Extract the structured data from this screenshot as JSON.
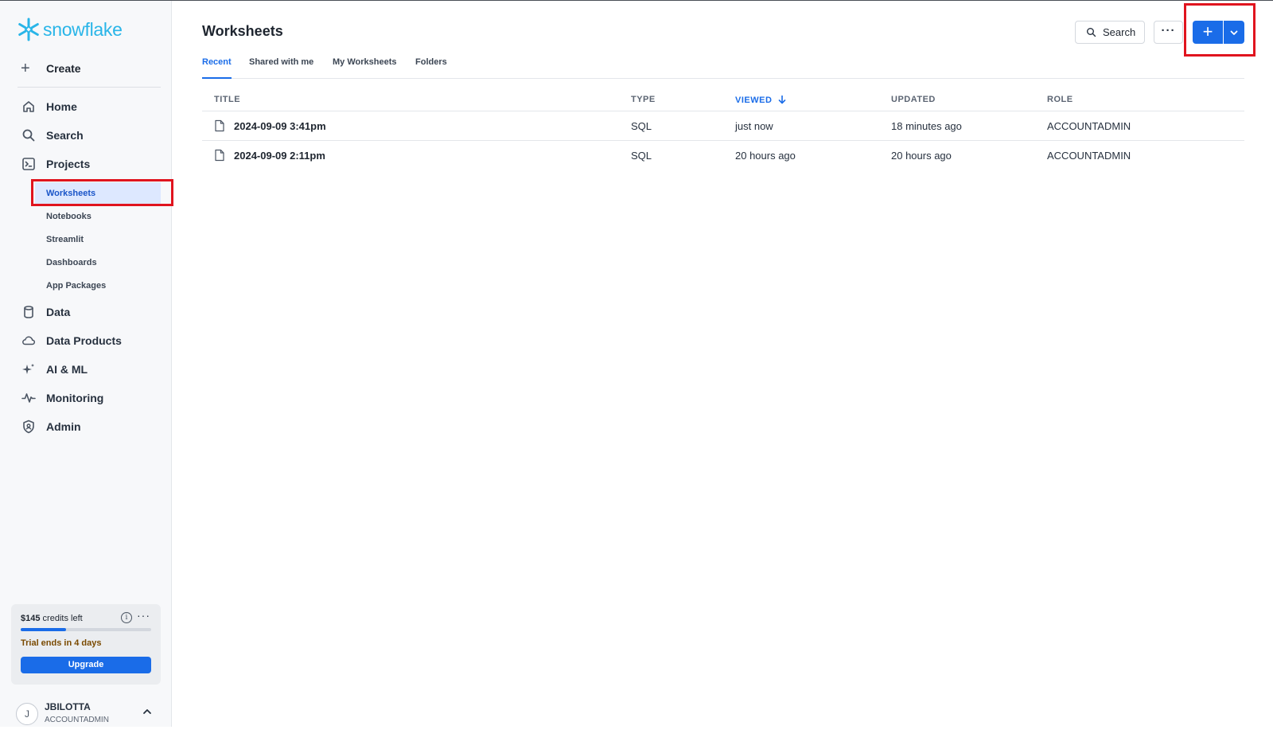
{
  "app": {
    "logo_text": "snowflake"
  },
  "sidebar": {
    "create_label": "Create",
    "items": [
      {
        "label": "Home",
        "icon": "home-icon"
      },
      {
        "label": "Search",
        "icon": "search-icon"
      },
      {
        "label": "Projects",
        "icon": "terminal-icon"
      },
      {
        "label": "Data",
        "icon": "database-icon"
      },
      {
        "label": "Data Products",
        "icon": "cloud-icon"
      },
      {
        "label": "AI & ML",
        "icon": "sparkle-icon"
      },
      {
        "label": "Monitoring",
        "icon": "activity-icon"
      },
      {
        "label": "Admin",
        "icon": "shield-icon"
      }
    ],
    "project_sub_items": [
      "Worksheets",
      "Notebooks",
      "Streamlit",
      "Dashboards",
      "App Packages"
    ],
    "active_sub_item": "Worksheets"
  },
  "credits": {
    "amount": "$145",
    "label": "credits left",
    "used_fraction": 0.35,
    "trial_text": "Trial ends in 4 days",
    "upgrade_label": "Upgrade"
  },
  "user": {
    "initial": "J",
    "name": "JBILOTTA",
    "role": "ACCOUNTADMIN"
  },
  "page": {
    "title": "Worksheets",
    "search_label": "Search",
    "more_label": "···",
    "add_label": "+"
  },
  "tabs": [
    "Recent",
    "Shared with me",
    "My Worksheets",
    "Folders"
  ],
  "active_tab": "Recent",
  "table": {
    "columns": [
      "TITLE",
      "TYPE",
      "VIEWED",
      "UPDATED",
      "ROLE"
    ],
    "sorted_column": "VIEWED",
    "sort_direction": "descending",
    "rows": [
      {
        "title": "2024-09-09 3:41pm",
        "type": "SQL",
        "viewed": "just now",
        "updated": "18 minutes ago",
        "role": "ACCOUNTADMIN"
      },
      {
        "title": "2024-09-09 2:11pm",
        "type": "SQL",
        "viewed": "20 hours ago",
        "updated": "20 hours ago",
        "role": "ACCOUNTADMIN"
      }
    ]
  },
  "colors": {
    "accent": "#1a6ce8",
    "brand": "#29b5e8",
    "highlight": "#e0141e",
    "active_nav_bg": "#dde8ff"
  }
}
